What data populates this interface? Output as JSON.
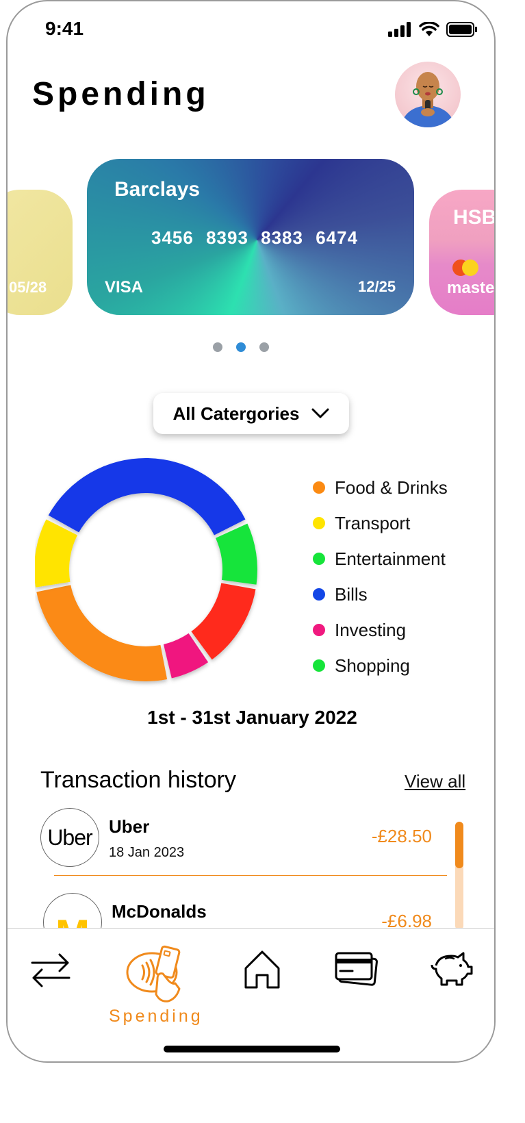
{
  "status": {
    "time": "9:41"
  },
  "header": {
    "title": "Spending"
  },
  "cards": [
    {
      "bank": "",
      "number": "",
      "expiry": "05/28",
      "brand": ""
    },
    {
      "bank": "Barclays",
      "number": "3456 8393 8383 6474",
      "expiry": "12/25",
      "brand": "VISA"
    },
    {
      "bank": "HSB",
      "number": "",
      "expiry": "",
      "brand": "maste"
    }
  ],
  "carousel": {
    "count": 3,
    "active_index": 1
  },
  "filter": {
    "selected": "All Catergories"
  },
  "chart_data": {
    "type": "pie",
    "categories": [
      "Bills",
      "Shopping",
      "Food & Drinks",
      "Investing",
      "Food & Drinks",
      "Transport"
    ],
    "values": [
      33,
      9,
      12,
      6,
      24,
      10
    ],
    "colors": [
      "#1338e8",
      "#16e43a",
      "#ff2a1a",
      "#f0197f",
      "#fb8a12",
      "#ffe400"
    ],
    "donut": true
  },
  "legend": [
    {
      "label": "Food & Drinks",
      "color": "#fb8a12"
    },
    {
      "label": "Transport",
      "color": "#ffe400"
    },
    {
      "label": "Entertainment",
      "color": "#16e43a"
    },
    {
      "label": "Bills",
      "color": "#1346e6"
    },
    {
      "label": "Investing",
      "color": "#f0197f"
    },
    {
      "label": "Shopping",
      "color": "#16e43a"
    }
  ],
  "date_range": "1st - 31st January 2022",
  "transactions": {
    "title": "Transaction history",
    "view_all": "View all",
    "items": [
      {
        "merchant": "Uber",
        "logo_text": "Uber",
        "date": "18 Jan 2023",
        "amount": "-£28.50"
      },
      {
        "merchant": "McDonalds",
        "logo_text": "M",
        "date": "",
        "amount": "-£6.98"
      }
    ]
  },
  "tabbar": {
    "active_label": "Spending",
    "items": [
      {
        "icon": "transfer-icon"
      },
      {
        "icon": "contactless-pay-icon"
      },
      {
        "icon": "home-icon"
      },
      {
        "icon": "cards-icon"
      },
      {
        "icon": "piggy-bank-icon"
      }
    ]
  },
  "colors": {
    "accent": "#f08a1c",
    "active_dot": "#2f8cd6"
  }
}
